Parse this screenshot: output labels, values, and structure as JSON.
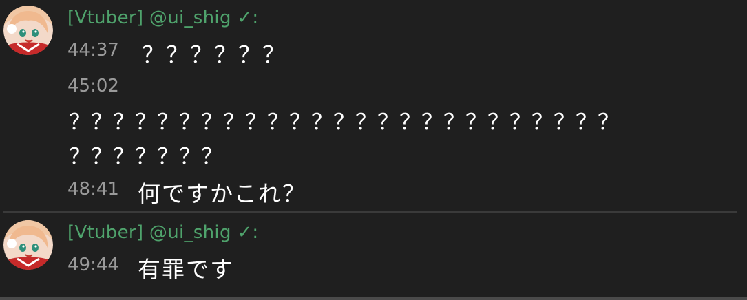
{
  "messages": [
    {
      "author": "[Vtuber] @ui_shig ✓:",
      "lines": [
        {
          "time": "44:37",
          "text": "？？？？？？"
        },
        {
          "time": "45:02",
          "text": "？？？？？？？？？？？？？？？？？？？？？？？？？",
          "text2": "？？？？？？？"
        },
        {
          "time": "48:41",
          "text": "何ですかこれ？"
        }
      ]
    },
    {
      "author": "[Vtuber] @ui_shig ✓:",
      "lines": [
        {
          "time": "49:44",
          "text": "有罪です"
        }
      ]
    }
  ],
  "colors": {
    "background": "#1f1f1f",
    "author": "#4fa36c",
    "timestamp": "#9a9a9a",
    "message": "#ffffff"
  },
  "avatar_icon": "anime-girl-avatar-icon"
}
